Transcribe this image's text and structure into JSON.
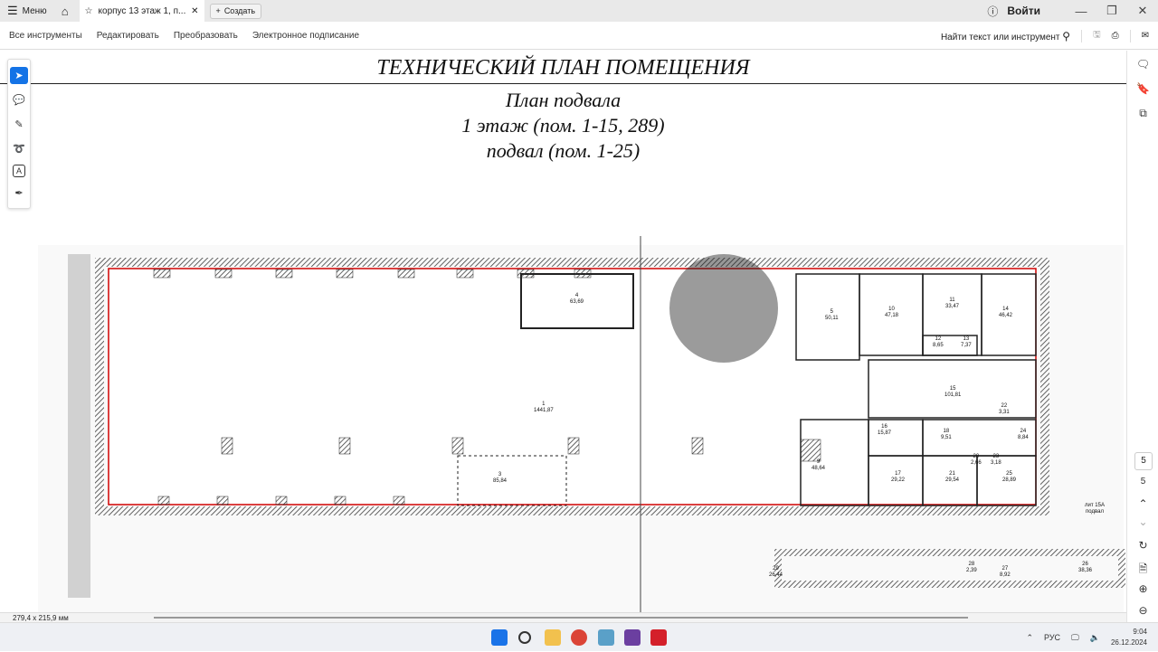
{
  "tabbar": {
    "menu": "Меню",
    "tab_title": "корпус 13 этаж 1, п...",
    "create": "Создать",
    "login": "Войти"
  },
  "toolbar": {
    "menus": [
      "Все инструменты",
      "Редактировать",
      "Преобразовать",
      "Электронное подписание"
    ],
    "search": "Найти текст или инструмент"
  },
  "document": {
    "title": "ТЕХНИЧЕСКИЙ ПЛАН ПОМЕЩЕНИЯ",
    "subtitle1": "План подвала",
    "subtitle2": "1 этаж (пом. 1-15, 289)",
    "subtitle3": "подвал (пом. 1-25)",
    "rooms": [
      {
        "num": "1",
        "area": "1441,87"
      },
      {
        "num": "4",
        "area": "63,69"
      },
      {
        "num": "3",
        "area": "85,84"
      },
      {
        "num": "5",
        "area": "50,11"
      },
      {
        "num": "10",
        "area": "47,18"
      },
      {
        "num": "11",
        "area": "33,47"
      },
      {
        "num": "14",
        "area": "46,42"
      },
      {
        "num": "12",
        "area": "8,65"
      },
      {
        "num": "13",
        "area": "7,37"
      },
      {
        "num": "15",
        "area": "101,81"
      },
      {
        "num": "9",
        "area": "48,64"
      },
      {
        "num": "16",
        "area": "15,87"
      },
      {
        "num": "17",
        "area": "29,22"
      },
      {
        "num": "21",
        "area": "29,54"
      },
      {
        "num": "25",
        "area": "28,89"
      },
      {
        "num": "18",
        "area": "9,51"
      },
      {
        "num": "20",
        "area": "2,66"
      },
      {
        "num": "23",
        "area": "3,18"
      },
      {
        "num": "22",
        "area": "3,31"
      },
      {
        "num": "24",
        "area": "8,84"
      },
      {
        "num": "26",
        "area": "38,36"
      },
      {
        "num": "27",
        "area": "8,92"
      },
      {
        "num": "28",
        "area": "2,39"
      },
      {
        "num": "29",
        "area": "26,44"
      }
    ],
    "sheet_label": "лит 15А подвал"
  },
  "right_sidebar": {
    "page_input": "5",
    "page_total": "5"
  },
  "status": {
    "page_size": "279,4 x 215,9 мм"
  },
  "taskbar": {
    "lang": "РУС",
    "time": "9:04",
    "date": "26.12.2024"
  },
  "colors": {
    "accent": "#1473e6",
    "plan_red": "#d00000"
  }
}
